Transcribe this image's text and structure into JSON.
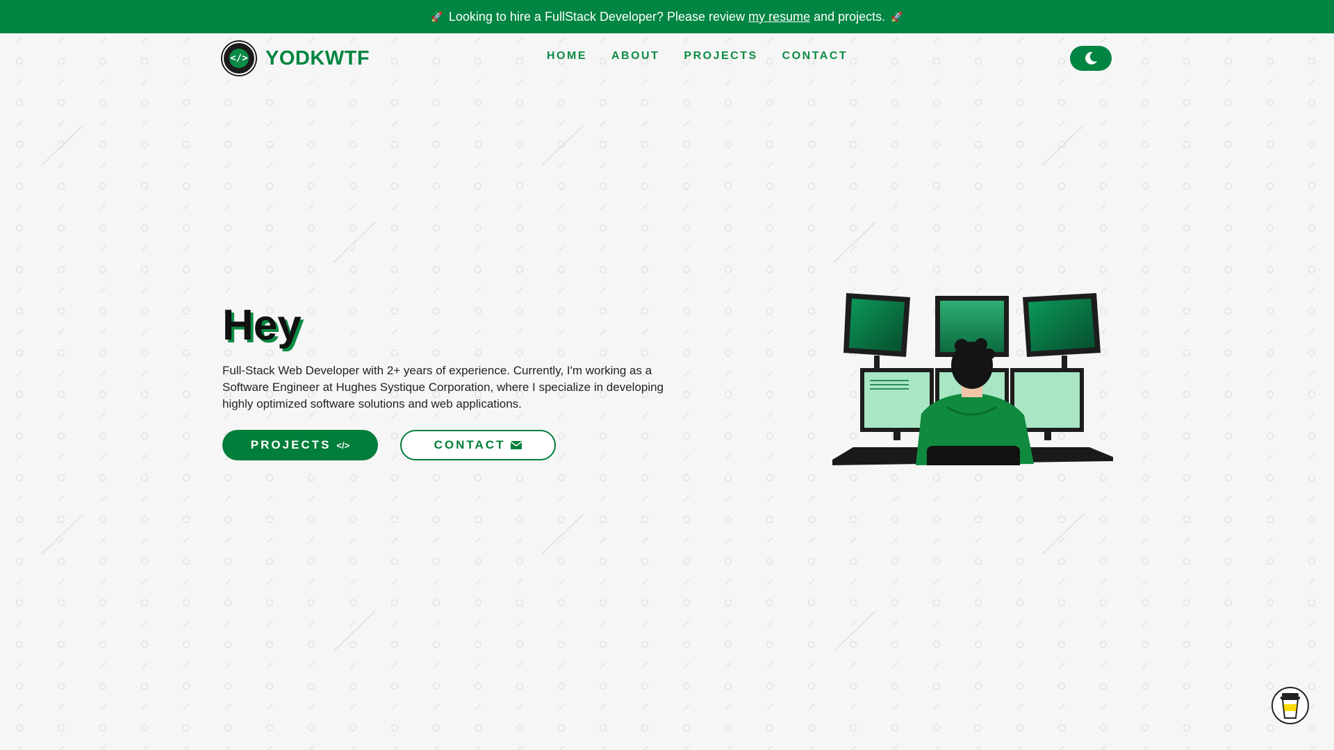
{
  "banner": {
    "rocket_icon": "rocket-icon",
    "text_before": "Looking to hire a FullStack Developer? Please review",
    "link_text": "my resume",
    "text_after": "and projects."
  },
  "nav": {
    "logo_text": "YODKWTF",
    "logo_icon": "code-icon",
    "items": [
      "HOME",
      "ABOUT",
      "PROJECTS",
      "CONTACT"
    ],
    "theme_toggle_icon": "moon-icon"
  },
  "hero": {
    "title": "Hey",
    "description": "Full-Stack Web Developer with 2+ years of experience. Currently, I'm working as a Software Engineer at Hughes Systique Corporation, where I specialize in developing highly optimized software solutions and web applications.",
    "buttons": {
      "projects_label": "PROJECTS",
      "projects_icon": "code-icon",
      "contact_label": "CONTACT",
      "contact_icon": "envelope-icon"
    },
    "illustration": "developer-at-monitors"
  },
  "floating": {
    "coffee_icon": "coffee-cup-icon"
  },
  "colors": {
    "accent": "#008542",
    "background": "#f6f6f6",
    "text": "#1a1a1a"
  }
}
